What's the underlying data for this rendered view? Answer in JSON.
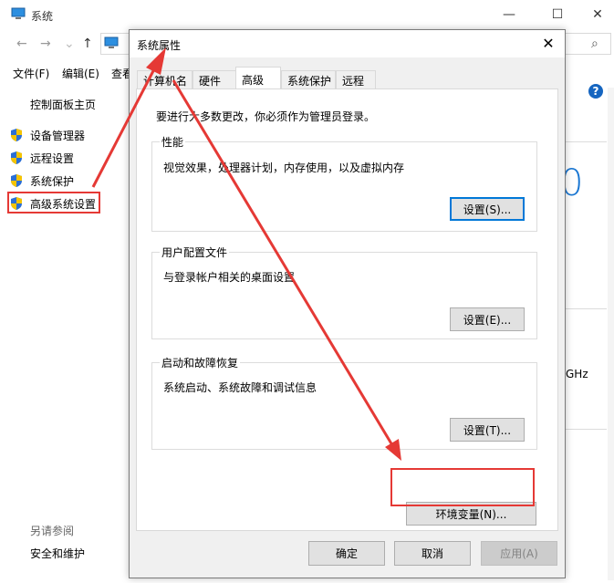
{
  "bg_window": {
    "title": "系统",
    "menu": [
      "文件(F)",
      "编辑(E)",
      "查看"
    ],
    "sidebar": {
      "home": "控制面板主页",
      "items": [
        {
          "label": "设备管理器",
          "icon": "uac-shield-icon"
        },
        {
          "label": "远程设置",
          "icon": "uac-shield-icon"
        },
        {
          "label": "系统保护",
          "icon": "uac-shield-icon"
        },
        {
          "label": "高级系统设置",
          "icon": "uac-shield-icon"
        }
      ],
      "see_also": "另请参阅",
      "security": "安全和维护"
    },
    "right": {
      "big_digit": "0",
      "ghz": "GHz"
    }
  },
  "dialog": {
    "title": "系统属性",
    "tabs": [
      "计算机名",
      "硬件",
      "高级",
      "系统保护",
      "远程"
    ],
    "active_tab": "高级",
    "intro": "要进行大多数更改，你必须作为管理员登录。",
    "groups": [
      {
        "legend": "性能",
        "desc": "视觉效果，处理器计划，内存使用，以及虚拟内存",
        "button": "设置(S)..."
      },
      {
        "legend": "用户配置文件",
        "desc": "与登录帐户相关的桌面设置",
        "button": "设置(E)..."
      },
      {
        "legend": "启动和故障恢复",
        "desc": "系统启动、系统故障和调试信息",
        "button": "设置(T)..."
      }
    ],
    "env_button": "环境变量(N)...",
    "ok": "确定",
    "cancel": "取消",
    "apply": "应用(A)"
  },
  "colors": {
    "annotation_red": "#e53935",
    "focus_blue": "#0078d7",
    "accent_blue": "#1976d2"
  }
}
